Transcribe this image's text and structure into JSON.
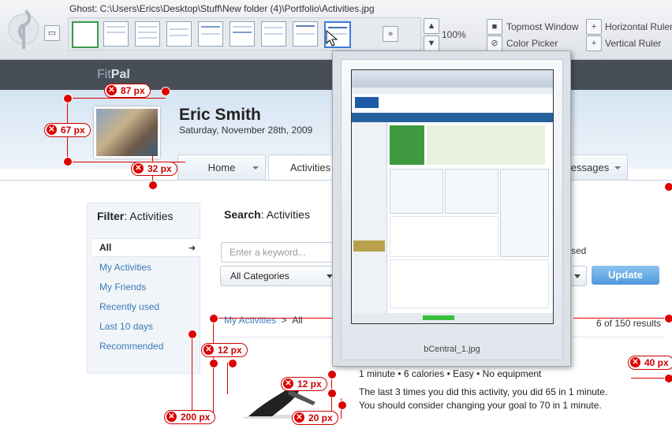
{
  "toolbar": {
    "ghost_path": "Ghost: C:\\Users\\Erics\\Desktop\\Stuff\\New folder (4)\\Portfolio\\Activities.jpg",
    "zoom": "100%",
    "topmost": "Topmost Window",
    "color_picker": "Color Picker",
    "horizontal_ruler": "Horizontal Ruler",
    "vertical_ruler": "Vertical Ruler"
  },
  "site": {
    "brand_a": "Fit",
    "brand_b": "Pal",
    "user_name": "Eric Smith",
    "user_date": "Saturday, November 28th, 2009",
    "tabs": [
      "Home",
      "Activities",
      "essages"
    ],
    "filter_title_b": "Filter",
    "filter_title_rest": ": Activities",
    "filters": [
      "All",
      "My Activities",
      "My Friends",
      "Recently used",
      "Last 10 days",
      "Recommended"
    ],
    "search_title_b": "Search",
    "search_title_rest": ": Activities",
    "keyword_placeholder": "Enter a keyword...",
    "category": "All Categories",
    "used": "sed",
    "update": "Update",
    "bc_link": "My Activities",
    "bc_sep": ">",
    "bc_current": "All",
    "results": "6 of 150 results",
    "meta": "1 minute  •  6 calories  •  Easy  •  No equipment",
    "last_line": "The last 3 times you did this activity, you did 65 in 1 minute.",
    "suggest_line": "You should consider changing your goal to 70 in 1 minute."
  },
  "popup": {
    "caption": "bCentral_1.jpg"
  },
  "measures": {
    "m87": "87 px",
    "m67": "67 px",
    "m32": "32 px",
    "m12a": "12 px",
    "m12b": "12 px",
    "m40": "40 px",
    "m200": "200 px",
    "m20": "20 px"
  }
}
